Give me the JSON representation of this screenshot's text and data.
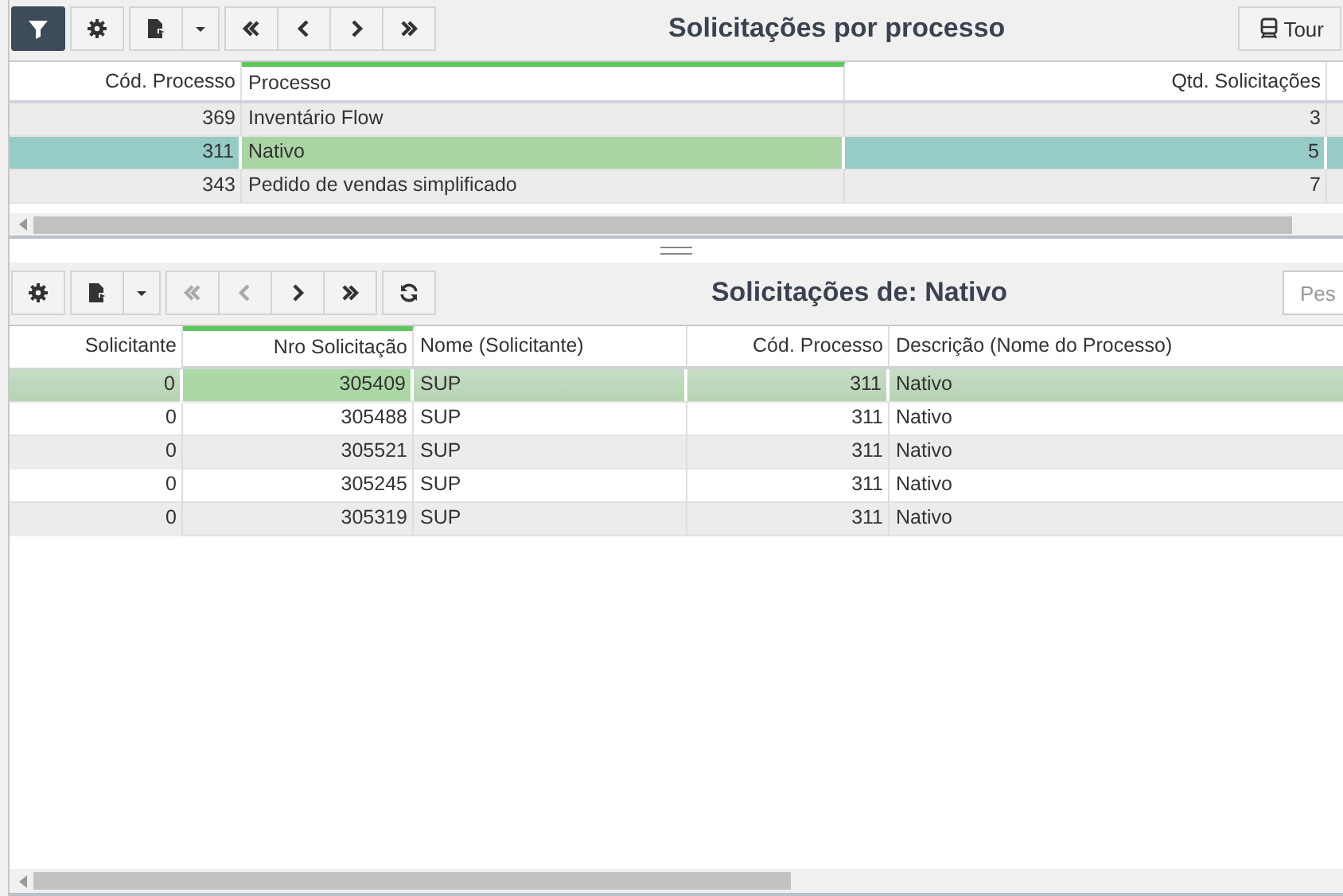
{
  "top_panel": {
    "title": "Solicitações por processo",
    "tour_button": {
      "label": "Tour"
    },
    "toolbar": [
      [
        {
          "kind": "filter",
          "active": true,
          "disabled": false
        }
      ],
      [
        {
          "kind": "settings",
          "active": false,
          "disabled": false
        }
      ],
      [
        {
          "kind": "export",
          "active": false,
          "disabled": false
        },
        {
          "kind": "dropdown",
          "active": false,
          "disabled": false
        }
      ],
      [
        {
          "kind": "first",
          "active": false,
          "disabled": false
        },
        {
          "kind": "prev",
          "active": false,
          "disabled": false
        },
        {
          "kind": "next",
          "active": false,
          "disabled": false
        },
        {
          "kind": "last",
          "active": false,
          "disabled": false
        }
      ]
    ],
    "table": {
      "columns": [
        {
          "label": "Cód. Processo",
          "kind": "number",
          "focused": false
        },
        {
          "label": "Processo",
          "kind": "text",
          "focused": true
        },
        {
          "label": "Qtd. Solicitações",
          "kind": "number",
          "focused": false
        }
      ],
      "rows": [
        {
          "selected": false,
          "cells": [
            "369",
            "Inventário Flow",
            "3"
          ]
        },
        {
          "selected": true,
          "cells": [
            "311",
            "Nativo",
            "5"
          ]
        },
        {
          "selected": false,
          "cells": [
            "343",
            "Pedido de vendas simplificado",
            "7"
          ]
        }
      ]
    }
  },
  "bottom_panel": {
    "title": "Solicitações de: Nativo",
    "search": {
      "placeholder": "Pes"
    },
    "toolbar": [
      [
        {
          "kind": "settings",
          "active": false,
          "disabled": false
        }
      ],
      [
        {
          "kind": "export",
          "active": false,
          "disabled": false
        },
        {
          "kind": "dropdown",
          "active": false,
          "disabled": false
        }
      ],
      [
        {
          "kind": "first",
          "active": false,
          "disabled": true
        },
        {
          "kind": "prev",
          "active": false,
          "disabled": true
        },
        {
          "kind": "next",
          "active": false,
          "disabled": false
        },
        {
          "kind": "last",
          "active": false,
          "disabled": false
        }
      ],
      [
        {
          "kind": "refresh",
          "active": false,
          "disabled": false
        }
      ]
    ],
    "table": {
      "columns": [
        {
          "label": "Solicitante",
          "kind": "number",
          "focused": false
        },
        {
          "label": "Nro Solicitação",
          "kind": "number",
          "focused": true
        },
        {
          "label": "Nome (Solicitante)",
          "kind": "text",
          "focused": false
        },
        {
          "label": "Cód. Processo",
          "kind": "number",
          "focused": false
        },
        {
          "label": "Descrição (Nome do Processo)",
          "kind": "text",
          "focused": false
        }
      ],
      "rows": [
        {
          "selected": true,
          "cells": [
            "0",
            "305409",
            "SUP",
            "311",
            "Nativo"
          ]
        },
        {
          "selected": false,
          "cells": [
            "0",
            "305488",
            "SUP",
            "311",
            "Nativo"
          ]
        },
        {
          "selected": false,
          "cells": [
            "0",
            "305521",
            "SUP",
            "311",
            "Nativo"
          ]
        },
        {
          "selected": false,
          "cells": [
            "0",
            "305245",
            "SUP",
            "311",
            "Nativo"
          ]
        },
        {
          "selected": false,
          "cells": [
            "0",
            "305319",
            "SUP",
            "311",
            "Nativo"
          ]
        }
      ]
    }
  }
}
